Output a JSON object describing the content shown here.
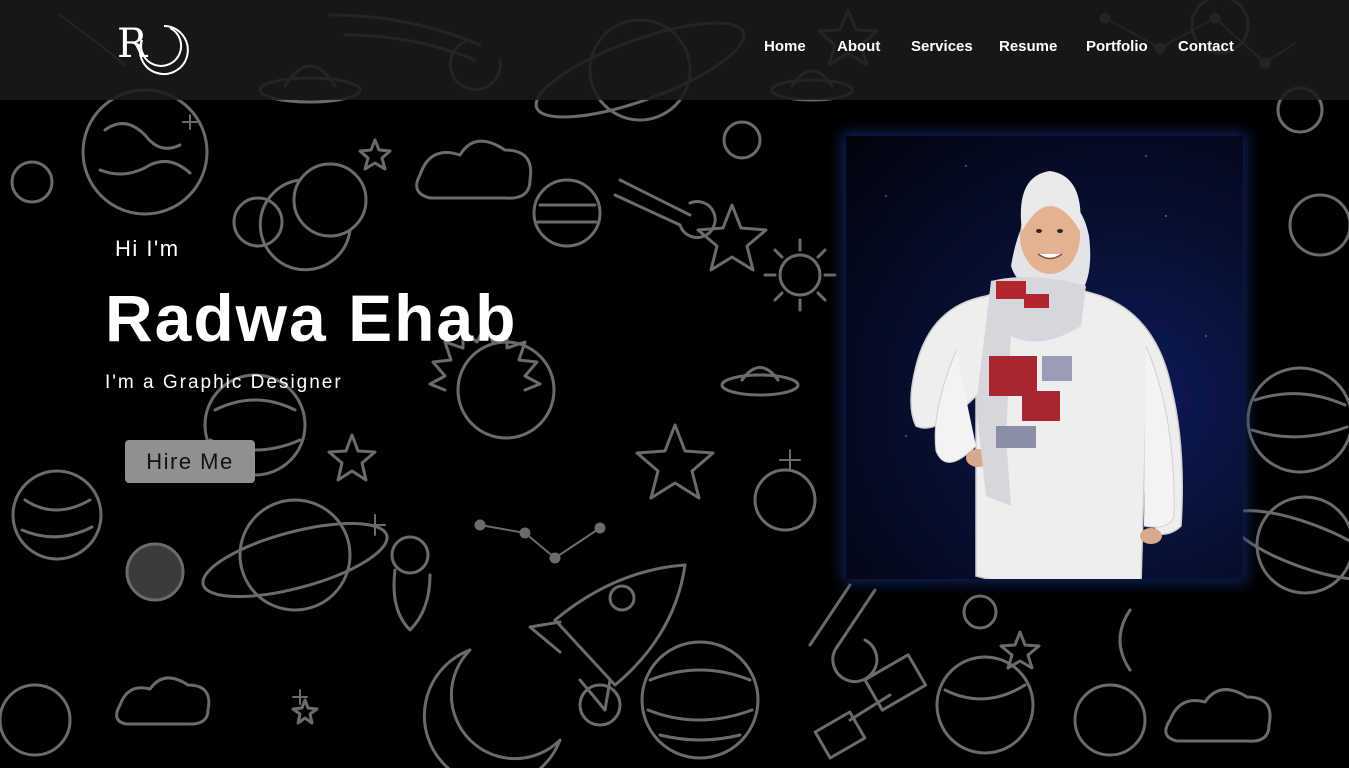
{
  "logo": {
    "letter": "R"
  },
  "nav": {
    "items": [
      {
        "id": "home",
        "label": "Home"
      },
      {
        "id": "about",
        "label": "About"
      },
      {
        "id": "services",
        "label": "Services"
      },
      {
        "id": "resume",
        "label": "Resume"
      },
      {
        "id": "portfolio",
        "label": "Portfolio"
      },
      {
        "id": "contact",
        "label": "Contact"
      }
    ]
  },
  "hero": {
    "greeting": "Hi I'm",
    "name": "Radwa Ehab",
    "role": "I'm a Graphic Designer",
    "cta_label": "Hire Me"
  },
  "colors": {
    "background": "#000000",
    "navbar": "#1a1a1a",
    "text": "#ffffff",
    "button": "#909090",
    "doodle": "#6b6b6b",
    "photo_glow": "#142d78"
  },
  "icons": [
    "logo-mark-icon",
    "space-doodle-background"
  ]
}
